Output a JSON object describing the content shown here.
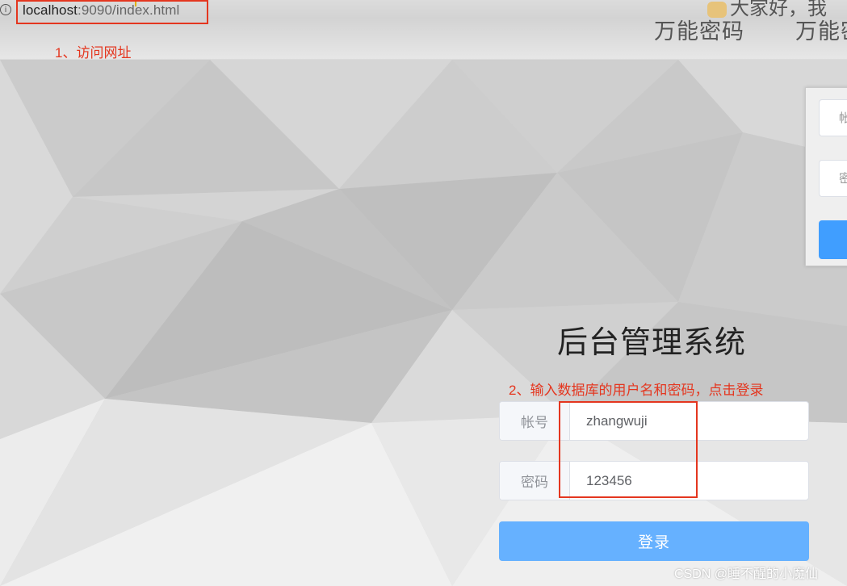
{
  "browser": {
    "url_host": "localhost",
    "url_rest": ":9090/index.html",
    "info_icon": "i"
  },
  "overlay": {
    "top_fragment": "大家好，我",
    "left_caption": "万能密码",
    "right_caption": "万能密"
  },
  "annotations": {
    "step1": "1、访问网址",
    "step2": "2、输入数据库的用户名和密码，点击登录"
  },
  "ghost_card": {
    "account_label": "帐",
    "password_label": "密"
  },
  "login": {
    "title": "后台管理系统",
    "account_label": "帐号",
    "account_value": "zhangwuji",
    "password_label": "密码",
    "password_value": "123456",
    "submit_label": "登录"
  },
  "watermark": "CSDN @睡不醒的小魔仙",
  "colors": {
    "annotation_red": "#e4361f",
    "button_blue": "#66b1ff"
  }
}
